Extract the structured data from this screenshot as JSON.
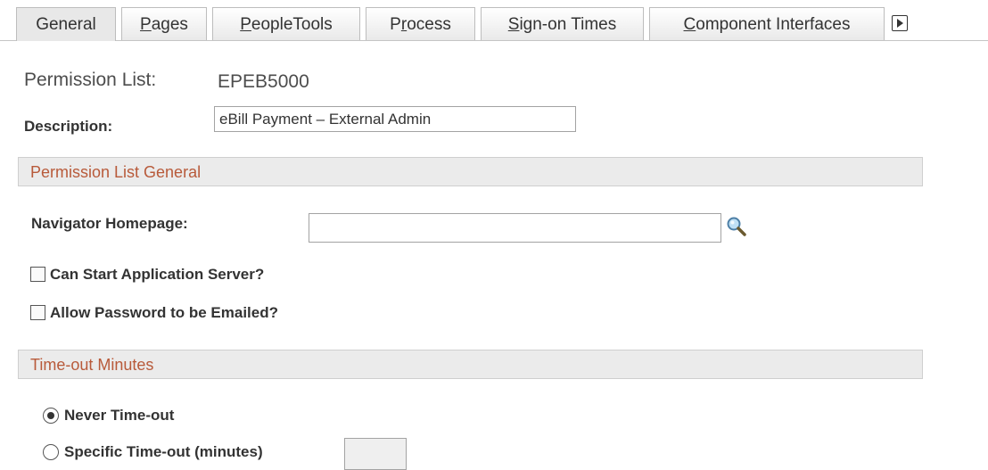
{
  "tabs": [
    {
      "prefix": "General",
      "accel": "",
      "rest": "",
      "active": true
    },
    {
      "prefix": "",
      "accel": "P",
      "rest": "ages",
      "active": false
    },
    {
      "prefix": "",
      "accel": "P",
      "rest": "eopleTools",
      "active": false
    },
    {
      "prefix": "P",
      "accel": "r",
      "rest": "ocess",
      "active": false
    },
    {
      "prefix": "",
      "accel": "S",
      "rest": "ign-on Times",
      "active": false
    },
    {
      "prefix": "",
      "accel": "C",
      "rest": "omponent Interfaces",
      "active": false
    }
  ],
  "header": {
    "permission_list_label": "Permission List:",
    "permission_list_value": "EPEB5000",
    "description_label": "Description:",
    "description_value": "eBill Payment – External Admin"
  },
  "general_section": {
    "title": "Permission List General",
    "navigator_label": "Navigator Homepage:",
    "navigator_value": "",
    "can_start_label": "Can Start Application Server?",
    "can_start_checked": false,
    "allow_password_label": "Allow Password to be Emailed?",
    "allow_password_checked": false
  },
  "timeout_section": {
    "title": "Time-out Minutes",
    "never_label": "Never Time-out",
    "specific_label": "Specific Time-out (minutes)",
    "selected": "never",
    "minutes_value": ""
  },
  "colors": {
    "section_title": "#b85a3a",
    "section_bg": "#ebebeb",
    "active_tab_bg": "#e8e8e8"
  }
}
